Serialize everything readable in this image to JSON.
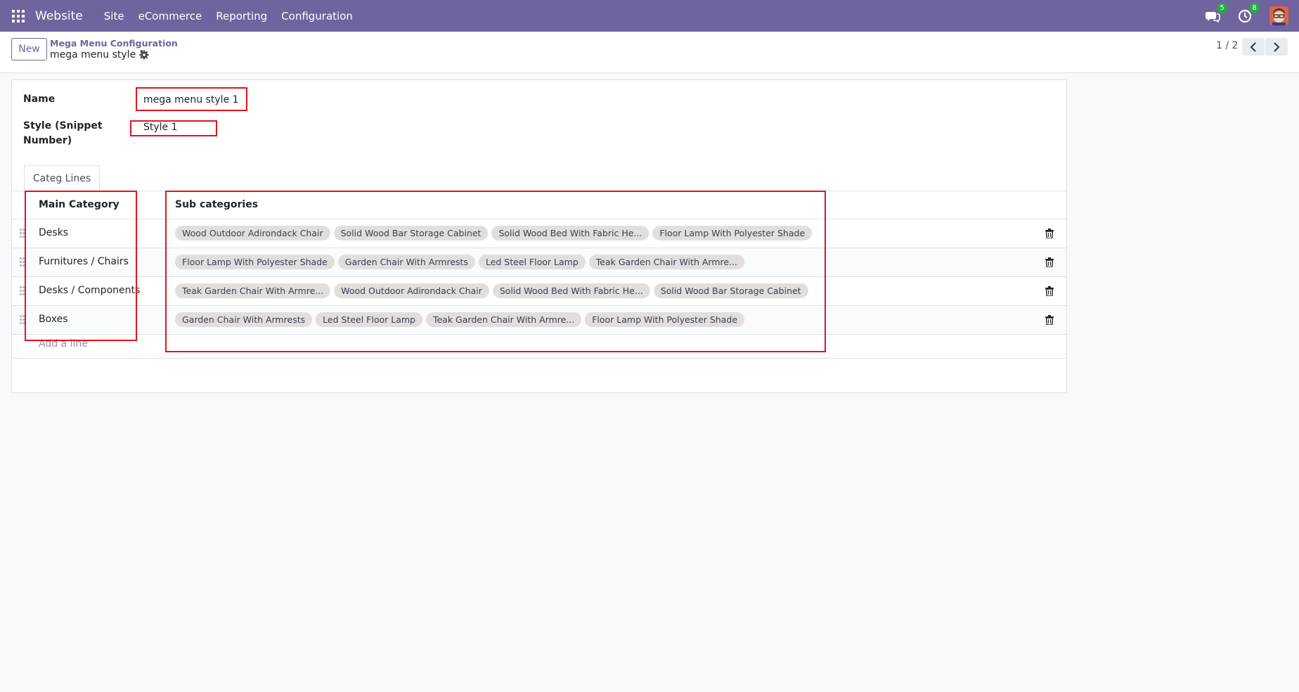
{
  "navbar": {
    "brand": "Website",
    "menus": [
      "Site",
      "eCommerce",
      "Reporting",
      "Configuration"
    ],
    "messages_badge": "5",
    "activities_badge": "8",
    "color": "#71639e"
  },
  "control_panel": {
    "new_label": "New",
    "breadcrumb": "Mega Menu Configuration",
    "record_title": "mega menu style 1",
    "pager": "1 / 2"
  },
  "form": {
    "name_label": "Name",
    "name_value": "mega menu style 1",
    "style_label_line1": "Style (Snippet",
    "style_label_line2": "Number)",
    "style_value": "Style 1",
    "tab_label": "Categ Lines"
  },
  "list": {
    "col_main": "Main Category",
    "col_sub": "Sub categories",
    "add_line": "Add a line",
    "rows": [
      {
        "main": "Desks",
        "tags": [
          "Wood Outdoor Adirondack Chair",
          "Solid Wood Bar Storage Cabinet",
          "Solid Wood Bed With Fabric He...",
          "Floor Lamp With Polyester Shade"
        ]
      },
      {
        "main": "Furnitures / Chairs",
        "tags": [
          "Floor Lamp With Polyester Shade",
          "Garden Chair With Armrests",
          "Led Steel Floor Lamp",
          "Teak Garden Chair With Armre..."
        ]
      },
      {
        "main": "Desks / Components",
        "tags": [
          "Teak Garden Chair With Armre...",
          "Wood Outdoor Adirondack Chair",
          "Solid Wood Bed With Fabric He...",
          "Solid Wood Bar Storage Cabinet"
        ]
      },
      {
        "main": "Boxes",
        "tags": [
          "Garden Chair With Armrests",
          "Led Steel Floor Lamp",
          "Teak Garden Chair With Armre...",
          "Floor Lamp With Polyester Shade"
        ]
      }
    ]
  },
  "icons": [
    "apps-icon",
    "chat-icon",
    "clock-icon",
    "avatar",
    "gear-icon",
    "chevron-left-icon",
    "chevron-right-icon",
    "drag-handle-icon",
    "trash-icon"
  ]
}
